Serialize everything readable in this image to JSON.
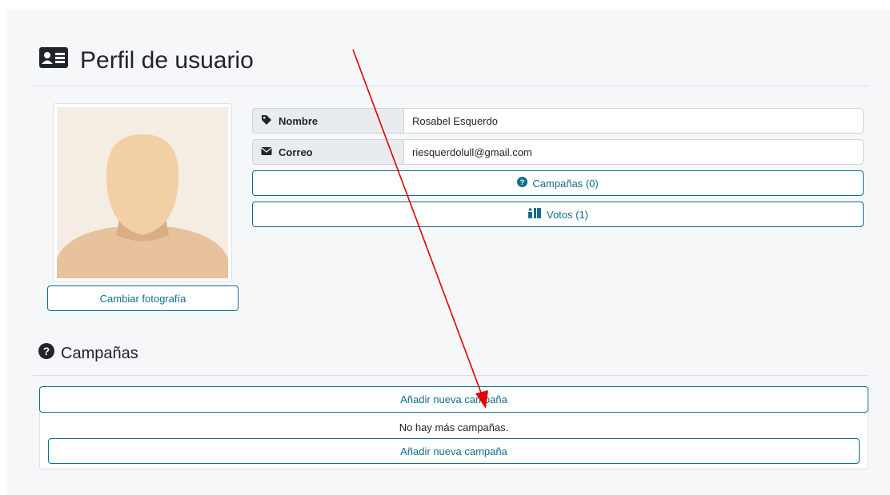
{
  "header": {
    "title": "Perfil de usuario"
  },
  "profile": {
    "change_photo_label": "Cambiar fotografía",
    "fields": [
      {
        "label": "Nombre",
        "value": "Rosabel Esquerdo",
        "icon": "tag-icon"
      },
      {
        "label": "Correo",
        "value": "riesquerdolull@gmail.com",
        "icon": "envelope-icon"
      }
    ],
    "campaigns_button": "Campañas (0)",
    "votes_button": "Votos (1)"
  },
  "campaigns": {
    "title": "Campañas",
    "add_top_label": "Añadir nueva campaña",
    "empty_text": "No hay más campañas.",
    "add_bottom_label": "Añadir nueva campaña"
  },
  "colors": {
    "accent": "#0f6f8a",
    "arrow": "#e00000",
    "background": "#f5f7f9"
  }
}
